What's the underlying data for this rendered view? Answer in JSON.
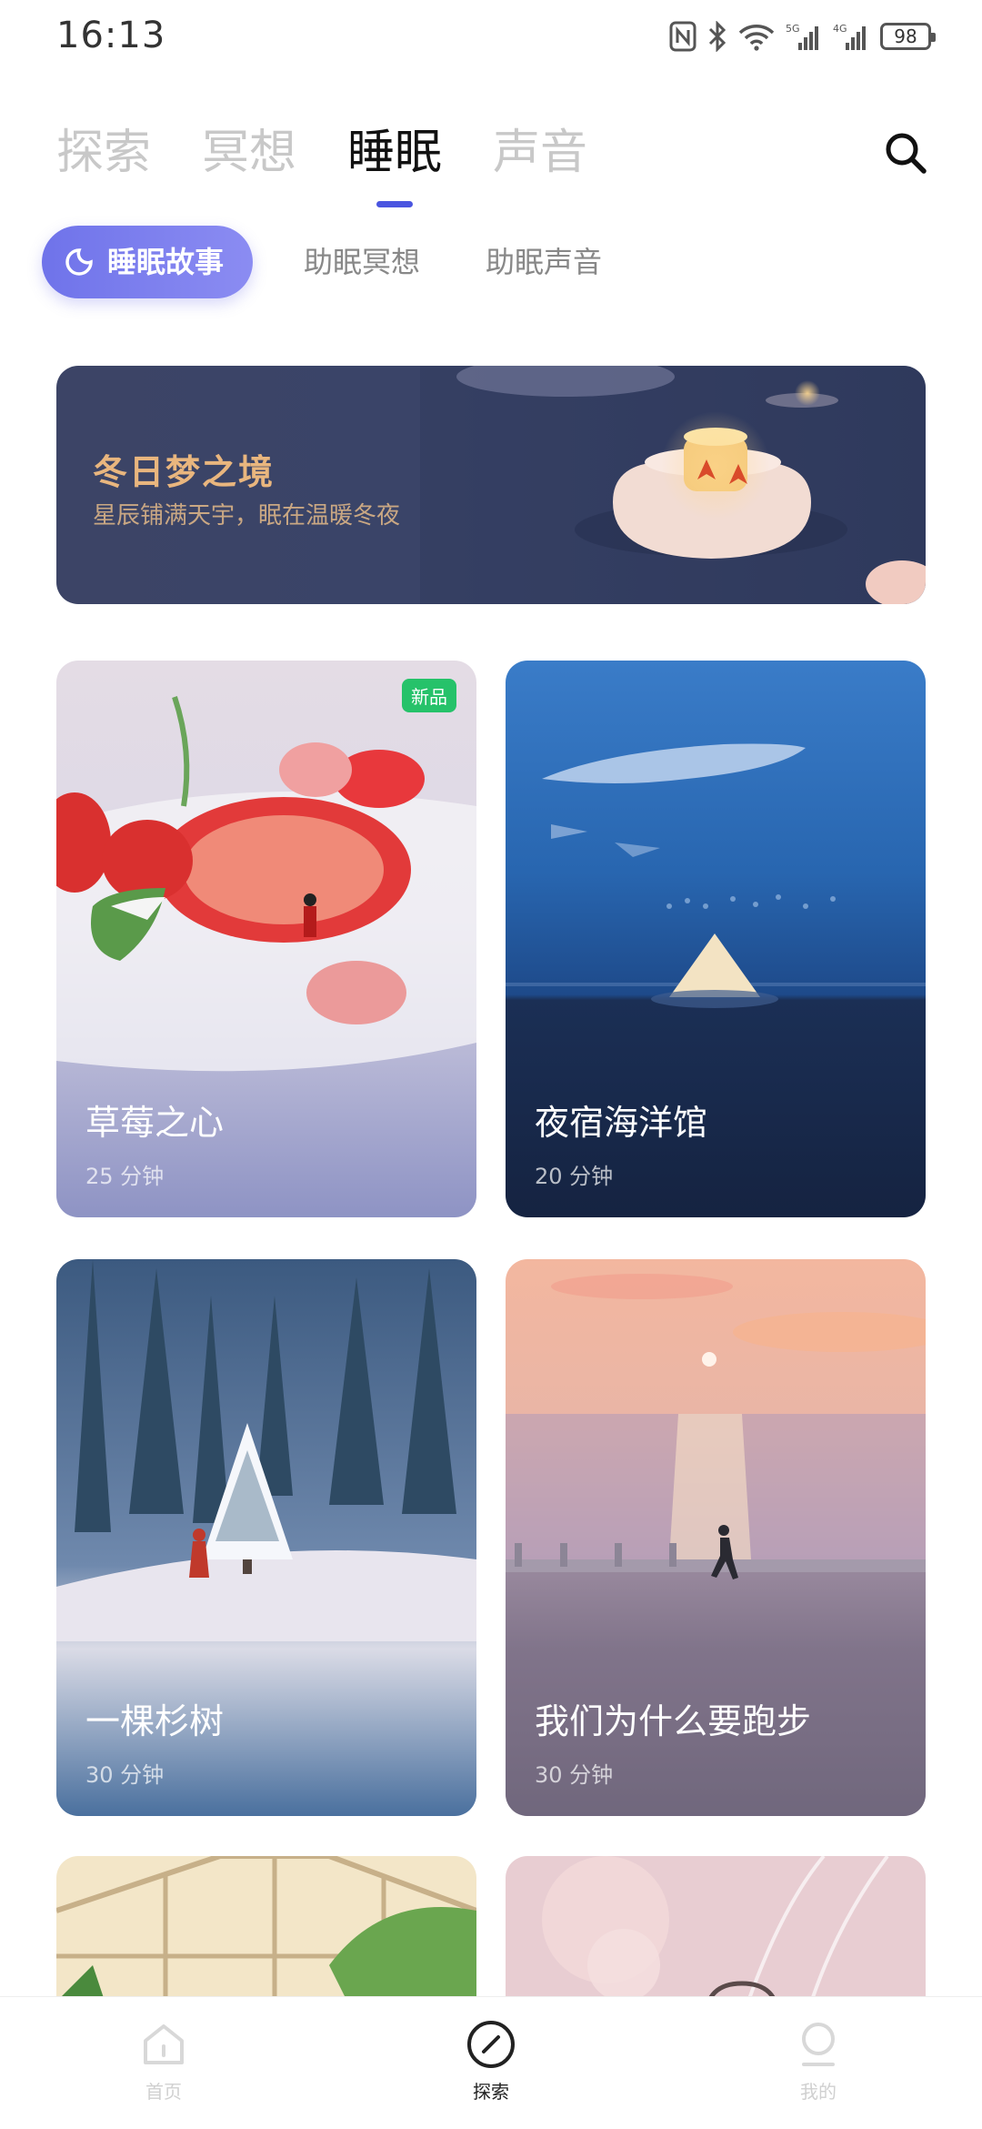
{
  "status_bar": {
    "time": "16:13",
    "battery": "98"
  },
  "top_tabs": [
    {
      "label": "探索",
      "active": false
    },
    {
      "label": "冥想",
      "active": false
    },
    {
      "label": "睡眠",
      "active": true
    },
    {
      "label": "声音",
      "active": false
    }
  ],
  "sub_tabs": [
    {
      "label": "睡眠故事",
      "active": true
    },
    {
      "label": "助眠冥想",
      "active": false
    },
    {
      "label": "助眠声音",
      "active": false
    }
  ],
  "banner": {
    "title": "冬日梦之境",
    "subtitle": "星辰铺满天宇，眠在温暖冬夜"
  },
  "cards": [
    {
      "title": "草莓之心",
      "duration": "25 分钟",
      "badge": "新品"
    },
    {
      "title": "夜宿海洋馆",
      "duration": "20 分钟"
    },
    {
      "title": "一棵杉树",
      "duration": "30 分钟"
    },
    {
      "title": "我们为什么要跑步",
      "duration": "30 分钟"
    }
  ],
  "bottom_nav": [
    {
      "label": "首页",
      "icon": "home-icon"
    },
    {
      "label": "探索",
      "icon": "compass-icon",
      "active": true
    },
    {
      "label": "我的",
      "icon": "profile-icon"
    }
  ],
  "colors": {
    "accent": "#4a55e0",
    "badge": "#26c26a"
  }
}
